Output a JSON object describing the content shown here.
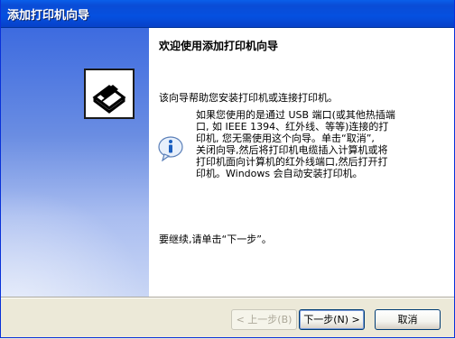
{
  "window": {
    "title": "添加打印机向导"
  },
  "content": {
    "heading": "欢迎使用添加打印机向导",
    "intro": "该向导帮助您安装打印机或连接打印机。",
    "info": "如果您使用的是通过 USB 端口(或其他热插端\n口, 如 IEEE 1394、红外线、等等)连接的打\n印机, 您无需使用这个向导。单击“取消”,\n关闭向导,然后将打印机电缆插入计算机或将\n打印机面向计算机的红外线端口,然后打开打\n印机。Windows 会自动安装打印机。",
    "continue": "要继续,请单击“下一步”。"
  },
  "buttons": {
    "back": "< 上一步(B)",
    "next": "下一步(N) >",
    "cancel": "取消"
  },
  "icons": {
    "wizard": "printer-icon",
    "info": "info-balloon-icon"
  },
  "colors": {
    "titlebar": "#0a4cd6",
    "panel": "#6a8de2",
    "face": "#ece9d8"
  }
}
